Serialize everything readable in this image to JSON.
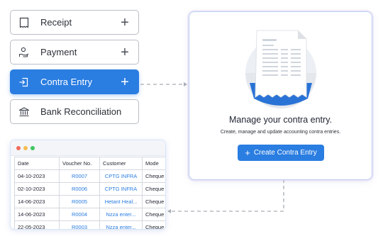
{
  "menu": {
    "items": [
      {
        "label": "Receipt",
        "icon": "receipt-icon",
        "active": false
      },
      {
        "label": "Payment",
        "icon": "payment-hand-icon",
        "active": false
      },
      {
        "label": "Contra Entry",
        "icon": "contra-entry-icon",
        "active": true
      },
      {
        "label": "Bank Reconciliation",
        "icon": "bank-icon",
        "active": false
      }
    ],
    "plus": "+"
  },
  "empty_state": {
    "title": "Manage your contra entry.",
    "subtitle": "Create, manage and update accounting contra entries.",
    "button_icon": "+",
    "button_label": "Create Contra Entry",
    "illustration": "document-list-illustration"
  },
  "table": {
    "window_dots": [
      "#f26b5b",
      "#f6bd4f",
      "#3fc460"
    ],
    "headers": [
      "Date",
      "Voucher No.",
      "Customer",
      "Mode"
    ],
    "rows": [
      [
        "04-10-2023",
        "R0007",
        "CPTG INFRA",
        "Cheque"
      ],
      [
        "02-10-2023",
        "R0006",
        "CPTG INFRA",
        "Cheque"
      ],
      [
        "14-06-2023",
        "R0005",
        "Hetant Heal...",
        "Cheque"
      ],
      [
        "14-06-2023",
        "R0004",
        "Nzza enter...",
        "Cheque"
      ],
      [
        "22-05-2023",
        "R0003",
        "Nzza enter...",
        "Cheque"
      ]
    ]
  },
  "colors": {
    "accent": "#2a7de1",
    "connector": "#a8adb5"
  }
}
